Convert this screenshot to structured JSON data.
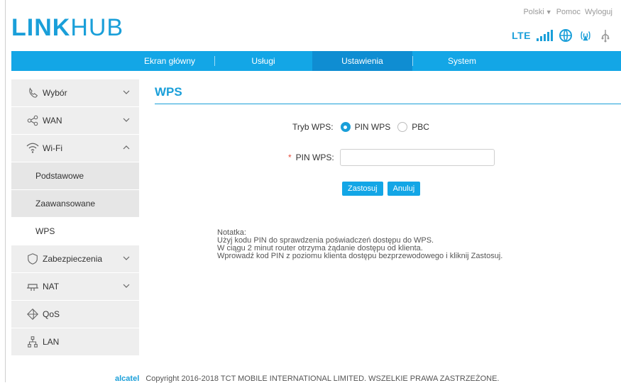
{
  "brand": {
    "logo_bold": "LINK",
    "logo_light": "HUB"
  },
  "toplinks": {
    "language": "Polski",
    "help": "Pomoc",
    "logout": "Wyloguj"
  },
  "status": {
    "network": "LTE",
    "signal_icon": "signal-bars-icon",
    "internet_icon": "globe-icon",
    "wifi_icon": "wifi-broadcast-icon",
    "usb_icon": "usb-icon"
  },
  "nav": {
    "items": [
      "Ekran główny",
      "Usługi",
      "Ustawienia",
      "System"
    ],
    "active_index": 2
  },
  "sidebar": {
    "items": [
      {
        "label": "Wybór",
        "icon": "phone-icon",
        "has_chevron": true,
        "expanded": false
      },
      {
        "label": "WAN",
        "icon": "network-icon",
        "has_chevron": true,
        "expanded": false
      },
      {
        "label": "Wi-Fi",
        "icon": "wifi-icon",
        "has_chevron": true,
        "expanded": true
      },
      {
        "label": "Zabezpieczenia",
        "icon": "shield-icon",
        "has_chevron": true,
        "expanded": false
      },
      {
        "label": "NAT",
        "icon": "nat-icon",
        "has_chevron": true,
        "expanded": false
      },
      {
        "label": "QoS",
        "icon": "qos-icon",
        "has_chevron": false,
        "expanded": false
      },
      {
        "label": "LAN",
        "icon": "lan-icon",
        "has_chevron": false,
        "expanded": false
      }
    ],
    "wifi_subitems": [
      "Podstawowe",
      "Zaawansowane",
      "WPS"
    ],
    "wifi_active_subitem": "WPS"
  },
  "page": {
    "title": "WPS",
    "wps_mode_label": "Tryb WPS:",
    "wps_mode_options": [
      "PIN WPS",
      "PBC"
    ],
    "wps_mode_selected": "PIN WPS",
    "pin_label": "PIN WPS:",
    "pin_value": "",
    "buttons": {
      "apply": "Zastosuj",
      "cancel": "Anuluj"
    },
    "note": {
      "title": "Notatka:",
      "lines": [
        "Użyj kodu PIN do sprawdzenia poświadczeń dostępu do WPS.",
        "W ciągu 2 minut router otrzyma żądanie dostępu od klienta.",
        "Wprowadź kod PIN z poziomu klienta dostępu bezprzewodowego i kliknij Zastosuj."
      ]
    }
  },
  "footer": {
    "brand": "alcatel",
    "text": "Copyright 2016-2018 TCT MOBILE INTERNATIONAL LIMITED. WSZELKIE PRAWA ZASTRZEŻONE."
  },
  "colors": {
    "accent": "#13a6e6",
    "accent_dark": "#0f8dd2",
    "text": "#333333"
  }
}
